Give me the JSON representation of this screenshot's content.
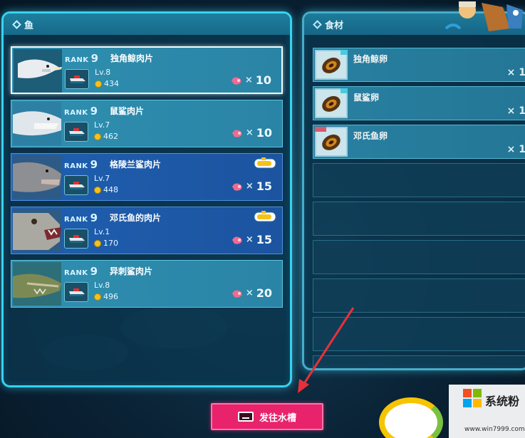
{
  "fish_panel": {
    "title": "鱼",
    "rows": [
      {
        "rank_label": "RANK",
        "rank": "9",
        "name": "独角鲸肉片",
        "level": "Lv.8",
        "coins": "434",
        "times": "×",
        "quantity": "10",
        "has_sub": false,
        "style": "selected",
        "fish": "narwhal"
      },
      {
        "rank_label": "RANK",
        "rank": "9",
        "name": "鼠鲨肉片",
        "level": "Lv.7",
        "coins": "462",
        "times": "×",
        "quantity": "10",
        "has_sub": false,
        "style": "normal",
        "fish": "shark"
      },
      {
        "rank_label": "RANK",
        "rank": "9",
        "name": "格陵兰鲨肉片",
        "level": "Lv.7",
        "coins": "448",
        "times": "×",
        "quantity": "15",
        "has_sub": true,
        "style": "highlight",
        "fish": "greenland-shark"
      },
      {
        "rank_label": "RANK",
        "rank": "9",
        "name": "邓氏鱼的肉片",
        "level": "Lv.1",
        "coins": "170",
        "times": "×",
        "quantity": "15",
        "has_sub": true,
        "style": "highlight",
        "fish": "dunkleosteus"
      },
      {
        "rank_label": "RANK",
        "rank": "9",
        "name": "异刺鲨肉片",
        "level": "Lv.8",
        "coins": "496",
        "times": "×",
        "quantity": "20",
        "has_sub": false,
        "style": "normal",
        "fish": "goblin-shark"
      }
    ]
  },
  "ingredient_panel": {
    "title": "食材",
    "rows": [
      {
        "name": "独角鲸卵",
        "times": "×",
        "quantity": "1",
        "tag": "cyan"
      },
      {
        "name": "鼠鲨卵",
        "times": "×",
        "quantity": "1",
        "tag": "cyan"
      },
      {
        "name": "邓氏鱼卵",
        "times": "×",
        "quantity": "1",
        "tag": "red"
      }
    ],
    "empty_slots": 6
  },
  "go_tank_button": {
    "label": "发往水槽"
  },
  "watermark": {
    "brand": "系统粉",
    "url": "www.win7999.com"
  },
  "colors": {
    "panel_border": "#36d3f0",
    "row_normal": "#2f8fb0",
    "row_highlight": "#1f5fb0",
    "button": "#e8236c",
    "arrow": "#e8303a"
  },
  "icons": [
    "diamond-icon",
    "boat-icon",
    "coin-icon",
    "meat-icon",
    "submarine-icon",
    "roe-icon",
    "keyboard-key-icon"
  ]
}
